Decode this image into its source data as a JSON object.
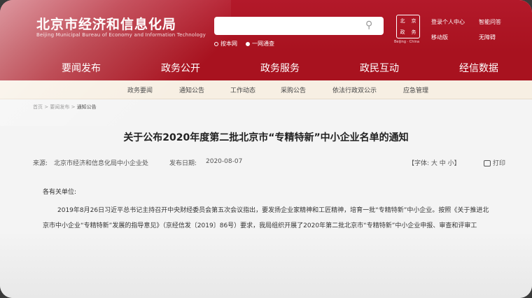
{
  "header": {
    "title": "北京市经济和信息化局",
    "subtitle": "Beijing Municipal Bureau of Economy and Information Technology",
    "search_placeholder": "",
    "radio_site": "按本网",
    "radio_all": "一网通查",
    "emblem_chars": [
      "北",
      "京",
      "政",
      "务"
    ],
    "emblem_caption": "Beijing · China",
    "links": [
      "登录个人中心",
      "智能问答",
      "移动版",
      "无障碍"
    ]
  },
  "nav": {
    "items": [
      "要闻发布",
      "政务公开",
      "政务服务",
      "政民互动",
      "经信数据"
    ]
  },
  "subnav": {
    "items": [
      "政务要闻",
      "通知公告",
      "工作动态",
      "采购公告",
      "依法行政双公示",
      "应急管理"
    ]
  },
  "breadcrumb": {
    "items": [
      "首页",
      "要闻发布",
      "通知公告"
    ],
    "sep": ">"
  },
  "article": {
    "title": "关于公布2020年度第二批北京市“专精特新”中小企业名单的通知",
    "source_label": "来源:",
    "source_value": "北京市经济和信息化局中小企业处",
    "date_label": "发布日期:",
    "date_value": "2020-08-07",
    "font_size_label": "【字体:  大  中  小】",
    "print_label": "打印",
    "salutation": "各有关单位:",
    "para1": "2019年8月26日习近平总书记主持召开中央财经委员会第五次会议指出，要发扬企业家精神和工匠精神，培育一批“专精特新”中小企业。按照《关于推进北",
    "para2": "京市中小企业“专精特新”发展的指导意见》（京经信发〔2019〕86号）要求，我局组织开展了2020年第二批北京市“专精特新”中小企业申报、审查和评审工"
  },
  "colors": {
    "brand_red": "#a8121f",
    "subnav_bg": "#f7efe3"
  }
}
